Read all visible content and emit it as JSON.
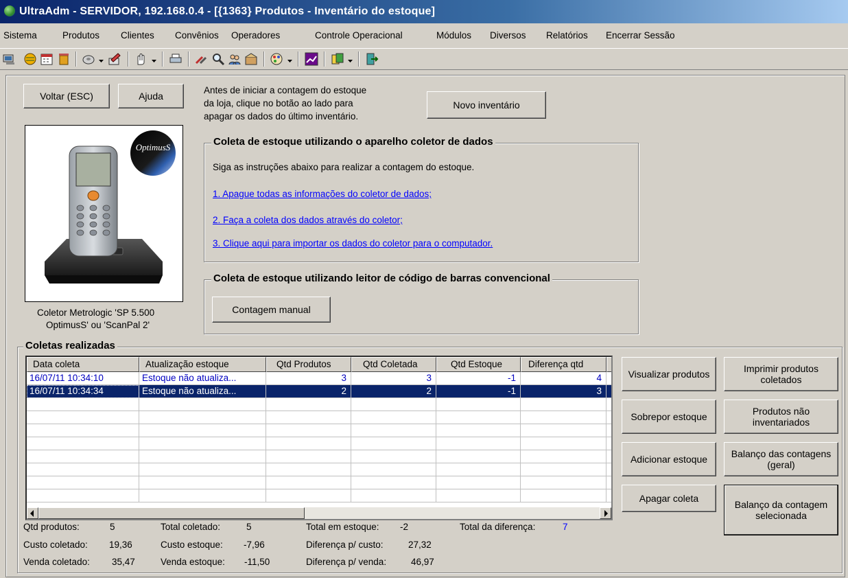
{
  "window": {
    "title": "UltraAdm - SERVIDOR, 192.168.0.4 - [{1363} Produtos - Inventário do estoque]"
  },
  "menu": {
    "items": [
      "Sistema",
      "Produtos",
      "Clientes",
      "Convênios",
      "Operadores",
      "Controle Operacional",
      "Módulos",
      "Diversos",
      "Relatórios",
      "Encerrar Sessão"
    ]
  },
  "top": {
    "back_button": "Voltar (ESC)",
    "help_button": "Ajuda",
    "instructions_line1": "Antes de iniciar a contagem do estoque",
    "instructions_line2": "da loja, clique no botão ao lado para",
    "instructions_line3": "apagar os dados do último inventário.",
    "new_inventory_button": "Novo inventário"
  },
  "device": {
    "brand_logo": "OptimusS",
    "caption_line1": "Coletor Metrologic 'SP 5.500",
    "caption_line2": "OptimusS' ou 'ScanPal 2'"
  },
  "collector_group": {
    "title": "Coleta de estoque utilizando o aparelho coletor de dados",
    "intro": "Siga as instruções abaixo para realizar a contagem do estoque.",
    "step1": "1. Apague todas as informações do coletor de dados;",
    "step2": "2. Faça a coleta dos dados através do coletor;",
    "step3": "3. Clique aqui para importar os dados do coletor para o computador."
  },
  "barcode_group": {
    "title": "Coleta de estoque utilizando leitor de código de barras convencional",
    "manual_button": "Contagem manual"
  },
  "collections": {
    "title": "Coletas realizadas",
    "columns": [
      "Data coleta",
      "Atualização estoque",
      "Qtd Produtos",
      "Qtd Coletada",
      "Qtd Estoque",
      "Diferença qtd"
    ],
    "rows": [
      {
        "date": "16/07/11 10:34:10",
        "update": "Estoque não atualiza...",
        "qtd_produtos": "3",
        "qtd_coletada": "3",
        "qtd_estoque": "-1",
        "diferenca": "4"
      },
      {
        "date": "16/07/11 10:34:34",
        "update": "Estoque não atualiza...",
        "qtd_produtos": "2",
        "qtd_coletada": "2",
        "qtd_estoque": "-1",
        "diferenca": "3"
      }
    ],
    "selected_row": 1
  },
  "actions": {
    "visualizar": "Visualizar produtos",
    "imprimir": "Imprimir produtos coletados",
    "sobrepor": "Sobrepor estoque",
    "nao_inventariados": "Produtos não inventariados",
    "adicionar": "Adicionar estoque",
    "balanco_geral": "Balanço das contagens (geral)",
    "apagar": "Apagar coleta",
    "balanco_selecionada": "Balanço da contagem selecionada"
  },
  "totals": {
    "qtd_produtos_label": "Qtd produtos:",
    "qtd_produtos_value": "5",
    "total_coletado_label": "Total coletado:",
    "total_coletado_value": "5",
    "total_estoque_label": "Total em estoque:",
    "total_estoque_value": "-2",
    "total_diferenca_label": "Total da diferença:",
    "total_diferenca_value": "7",
    "custo_coletado_label": "Custo coletado:",
    "custo_coletado_value": "19,36",
    "custo_estoque_label": "Custo estoque:",
    "custo_estoque_value": "-7,96",
    "diferenca_custo_label": "Diferença p/ custo:",
    "diferenca_custo_value": "27,32",
    "venda_coletado_label": "Venda coletado:",
    "venda_coletado_value": "35,47",
    "venda_estoque_label": "Venda estoque:",
    "venda_estoque_value": "-11,50",
    "diferenca_venda_label": "Diferença p/ venda:",
    "diferenca_venda_value": "46,97"
  },
  "colors": {
    "title_bar": "#0a246a",
    "selection": "#0a246a",
    "link": "#0000ff",
    "face": "#d4d0c8"
  }
}
